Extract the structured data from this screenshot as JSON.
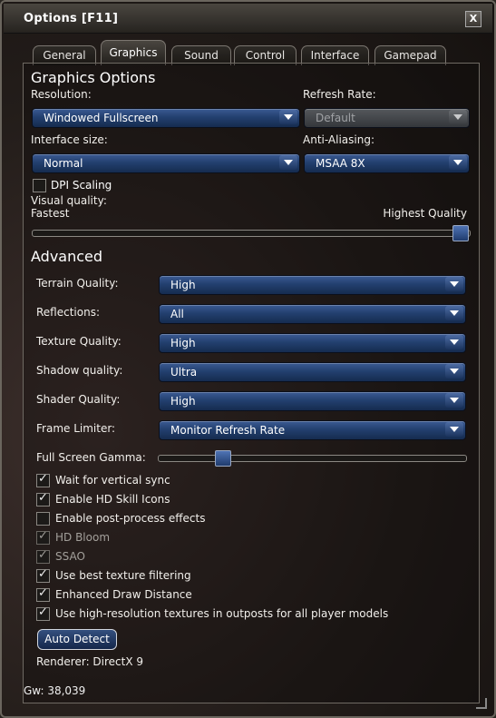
{
  "window": {
    "title": "Options  [F11]",
    "close_glyph": "X",
    "close_icon": "close-icon"
  },
  "tabs": [
    "General",
    "Graphics",
    "Sound",
    "Control",
    "Interface",
    "Gamepad"
  ],
  "active_tab": "Graphics",
  "graphics": {
    "heading": "Graphics Options",
    "resolution_label": "Resolution:",
    "resolution_value": "Windowed Fullscreen",
    "refresh_rate_label": "Refresh Rate:",
    "refresh_rate_value": "Default",
    "interface_size_label": "Interface size:",
    "interface_size_value": "Normal",
    "anti_aliasing_label": "Anti-Aliasing:",
    "anti_aliasing_value": "MSAA 8X",
    "dpi_scaling_label": "DPI Scaling",
    "dpi_scaling_checked": false,
    "visual_quality_label": "Visual quality:",
    "visual_quality_min": "Fastest",
    "visual_quality_max": "Highest Quality",
    "visual_quality_level": 1.0
  },
  "advanced": {
    "heading": "Advanced",
    "rows": [
      {
        "label": "Terrain Quality:",
        "value": "High"
      },
      {
        "label": "Reflections:",
        "value": "All"
      },
      {
        "label": "Texture Quality:",
        "value": "High"
      },
      {
        "label": "Shadow quality:",
        "value": "Ultra"
      },
      {
        "label": "Shader Quality:",
        "value": "High"
      },
      {
        "label": "Frame Limiter:",
        "value": "Monitor Refresh Rate"
      }
    ],
    "gamma_label": "Full Screen Gamma:",
    "gamma_level": 0.19,
    "checkboxes": [
      {
        "label": "Wait for vertical sync",
        "checked": true,
        "enabled": true
      },
      {
        "label": "Enable HD Skill Icons",
        "checked": true,
        "enabled": true
      },
      {
        "label": "Enable post-process effects",
        "checked": false,
        "enabled": true
      },
      {
        "label": "HD Bloom",
        "checked": true,
        "enabled": false
      },
      {
        "label": "SSAO",
        "checked": true,
        "enabled": false
      },
      {
        "label": "Use best texture filtering",
        "checked": true,
        "enabled": true
      },
      {
        "label": "Enhanced Draw Distance",
        "checked": true,
        "enabled": true
      },
      {
        "label": "Use high-resolution textures in outposts for all player models",
        "checked": true,
        "enabled": true
      }
    ],
    "auto_detect_label": "Auto Detect",
    "renderer_text": "Renderer: DirectX 9"
  },
  "footer": {
    "gw_text": "Gw: 38,039"
  },
  "colors": {
    "dropdown_blue": "#23406f",
    "panel_border": "#6f6a63",
    "window_bg": "#231d1a"
  }
}
